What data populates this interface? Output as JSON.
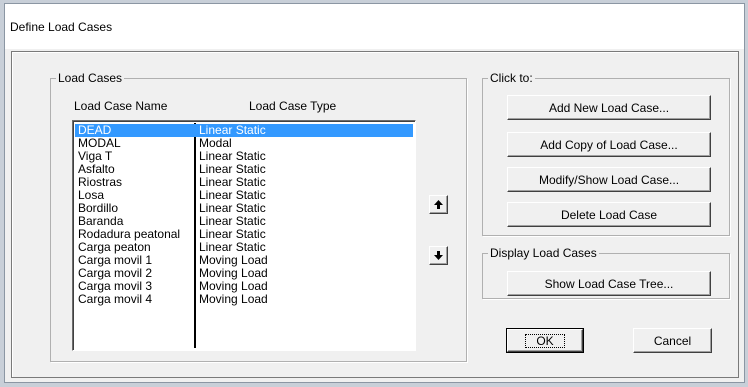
{
  "window": {
    "title": "Define Load Cases"
  },
  "load_cases": {
    "group_label": "Load Cases",
    "columns": [
      "Load Case Name",
      "Load Case Type"
    ],
    "rows": [
      {
        "name": "DEAD",
        "type": "Linear Static",
        "selected": true
      },
      {
        "name": "MODAL",
        "type": "Modal"
      },
      {
        "name": "Viga T",
        "type": "Linear Static"
      },
      {
        "name": "Asfalto",
        "type": "Linear Static"
      },
      {
        "name": "Riostras",
        "type": "Linear Static"
      },
      {
        "name": "Losa",
        "type": "Linear Static"
      },
      {
        "name": "Bordillo",
        "type": "Linear Static"
      },
      {
        "name": "Baranda",
        "type": "Linear Static"
      },
      {
        "name": "Rodadura peatonal",
        "type": "Linear Static"
      },
      {
        "name": "Carga peaton",
        "type": "Linear Static"
      },
      {
        "name": "Carga movil 1",
        "type": "Moving Load"
      },
      {
        "name": "Carga movil 2",
        "type": "Moving Load"
      },
      {
        "name": "Carga movil 3",
        "type": "Moving Load"
      },
      {
        "name": "Carga movil 4",
        "type": "Moving Load"
      }
    ],
    "move_up_icon": "arrow-up-icon",
    "move_down_icon": "arrow-down-icon"
  },
  "click_to": {
    "group_label": "Click to:",
    "add_new": "Add New Load Case...",
    "add_copy": "Add Copy of Load Case...",
    "modify_show": "Modify/Show Load Case...",
    "delete": "Delete Load Case"
  },
  "display": {
    "group_label": "Display Load Cases",
    "show_tree": "Show Load Case Tree..."
  },
  "footer": {
    "ok": "OK",
    "cancel": "Cancel"
  },
  "colors": {
    "selection": "#3399ff",
    "dialog_bg": "#f0f0f0"
  }
}
